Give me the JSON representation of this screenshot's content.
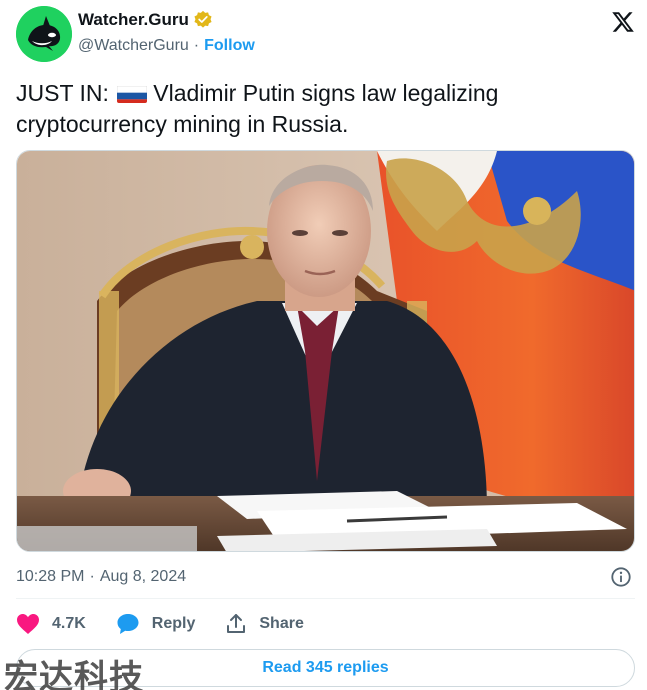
{
  "author": {
    "display_name": "Watcher.Guru",
    "handle": "@WatcherGuru",
    "separator": "·",
    "follow_label": "Follow",
    "avatar_color": "#1fd15f",
    "verified_badge_color": "#e2b719"
  },
  "tweet": {
    "prefix": "JUST IN:",
    "flag_icon": "russia-flag-icon",
    "body": "Vladimir Putin signs law legalizing cryptocurrency mining in Russia."
  },
  "media": {
    "icon": "photo"
  },
  "meta": {
    "time": "10:28 PM",
    "separator": "·",
    "date": "Aug 8, 2024",
    "info_icon": "info-icon"
  },
  "actions": {
    "likes": "4.7K",
    "reply_label": "Reply",
    "share_label": "Share",
    "like_color": "#f91880",
    "reply_color": "#1d9bf0"
  },
  "read_replies_label": "Read 345 replies",
  "watermark": "宏达科技"
}
